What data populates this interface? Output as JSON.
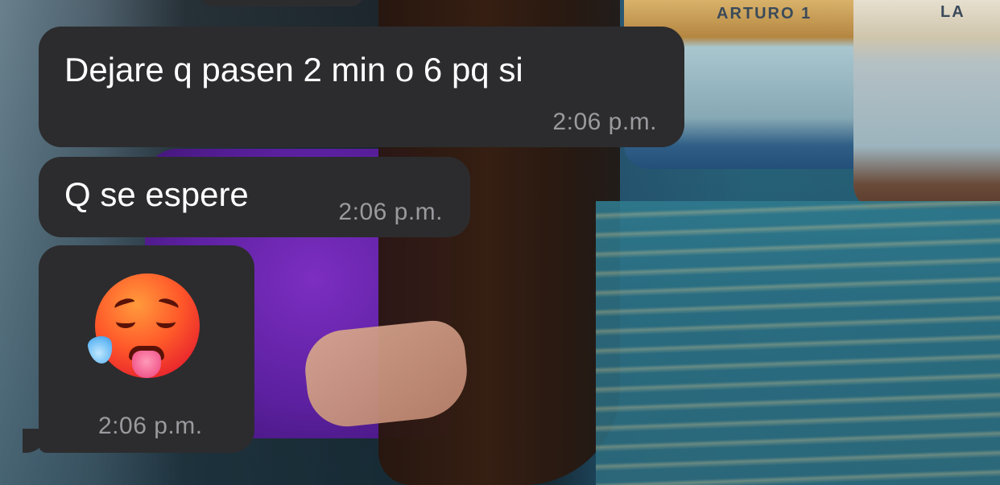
{
  "wallpaper": {
    "boat_labels": [
      "ARTURO 1",
      "LA"
    ]
  },
  "messages": [
    {
      "text": "Dejare q pasen 2 min o 6 pq si",
      "time": "2:06 p.m."
    },
    {
      "text": "Q se espere",
      "time": "2:06 p.m."
    },
    {
      "emoji": "hot-face-sweat-tongue",
      "time": "2:06 p.m."
    }
  ],
  "colors": {
    "bubble_bg": "#2c2c2e",
    "text": "#ffffff",
    "time": "#9a9a9f"
  }
}
